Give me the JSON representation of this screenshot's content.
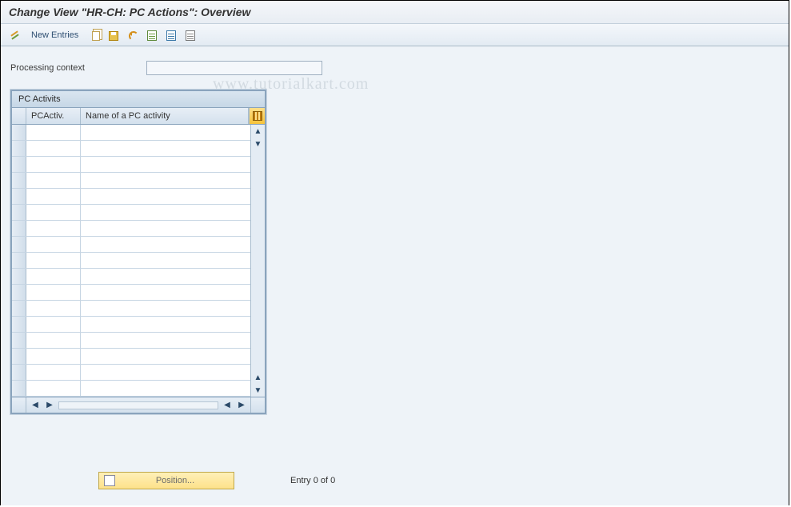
{
  "title": "Change View \"HR-CH: PC Actions\": Overview",
  "toolbar": {
    "new_entries": "New Entries"
  },
  "field": {
    "processing_context_label": "Processing context",
    "processing_context_value": ""
  },
  "table": {
    "title": "PC Activits",
    "col1": "PCActiv.",
    "col2": "Name of a PC activity",
    "rows": [
      {
        "pcactiv": "",
        "name": ""
      },
      {
        "pcactiv": "",
        "name": ""
      },
      {
        "pcactiv": "",
        "name": ""
      },
      {
        "pcactiv": "",
        "name": ""
      },
      {
        "pcactiv": "",
        "name": ""
      },
      {
        "pcactiv": "",
        "name": ""
      },
      {
        "pcactiv": "",
        "name": ""
      },
      {
        "pcactiv": "",
        "name": ""
      },
      {
        "pcactiv": "",
        "name": ""
      },
      {
        "pcactiv": "",
        "name": ""
      },
      {
        "pcactiv": "",
        "name": ""
      },
      {
        "pcactiv": "",
        "name": ""
      },
      {
        "pcactiv": "",
        "name": ""
      },
      {
        "pcactiv": "",
        "name": ""
      },
      {
        "pcactiv": "",
        "name": ""
      },
      {
        "pcactiv": "",
        "name": ""
      },
      {
        "pcactiv": "",
        "name": ""
      }
    ]
  },
  "scroll": {
    "up": "▲",
    "down": "▼",
    "left": "◀",
    "right": "▶"
  },
  "footer": {
    "position_button": "Position...",
    "status": "Entry 0 of 0"
  },
  "watermark": "www.tutorialkart.com"
}
